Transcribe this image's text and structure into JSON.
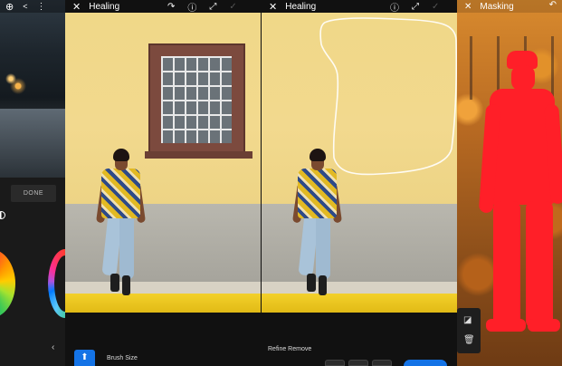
{
  "left_panel": {
    "done_label": "DONE",
    "icons": [
      "add-circle-icon",
      "share-icon",
      "more-icon",
      "chevron-left-icon"
    ]
  },
  "center": {
    "left_pane": {
      "title": "Healing",
      "icons": [
        "close-icon",
        "redo-icon",
        "info-icon",
        "expand-icon"
      ]
    },
    "right_pane": {
      "title": "Healing",
      "icons": [
        "close-icon",
        "info-icon",
        "expand-icon",
        "check-icon"
      ]
    },
    "bottom": {
      "brush_label": "Brush Size",
      "refine_label": "Refine Remove"
    }
  },
  "right_panel": {
    "title": "Masking",
    "icons": [
      "close-icon",
      "undo-icon",
      "mask-invert-icon",
      "trash-icon"
    ]
  },
  "colors": {
    "accent": "#1473e6",
    "mask": "#ff1f28",
    "wall": "#f2d98e",
    "curb": "#f3d12b"
  }
}
